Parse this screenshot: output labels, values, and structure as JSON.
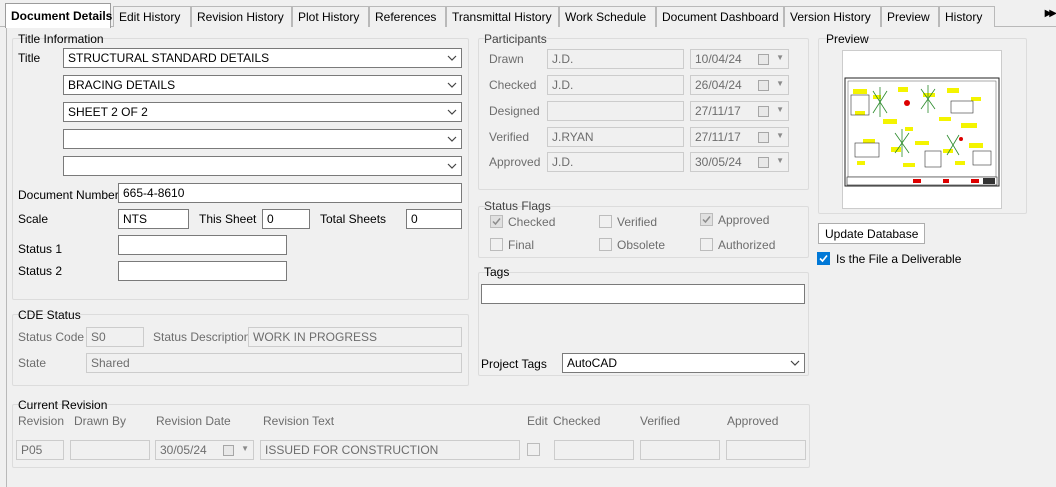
{
  "tabs": [
    {
      "label": "Document Details"
    },
    {
      "label": "Edit History"
    },
    {
      "label": "Revision History"
    },
    {
      "label": "Plot History"
    },
    {
      "label": "References"
    },
    {
      "label": "Transmittal History"
    },
    {
      "label": "Work Schedule"
    },
    {
      "label": "Document Dashboard"
    },
    {
      "label": "Version History"
    },
    {
      "label": "Preview"
    },
    {
      "label": "History"
    }
  ],
  "tab_scroll": "▶▶",
  "title_info": {
    "group_title": "Title Information",
    "title_label": "Title",
    "title_lines": [
      "STRUCTURAL STANDARD DETAILS",
      "BRACING DETAILS",
      "SHEET 2 OF 2",
      "",
      ""
    ],
    "doc_number_label": "Document Number",
    "doc_number": "665-4-8610",
    "scale_label": "Scale",
    "scale": "NTS",
    "this_sheet_label": "This Sheet",
    "this_sheet": "0",
    "total_sheets_label": "Total Sheets",
    "total_sheets": "0",
    "status1_label": "Status 1",
    "status1": "",
    "status2_label": "Status 2",
    "status2": ""
  },
  "participants": {
    "group_title": "Participants",
    "rows": [
      {
        "role": "Drawn",
        "name": "J.D.",
        "date": "10/04/24"
      },
      {
        "role": "Checked",
        "name": "J.D.",
        "date": "26/04/24"
      },
      {
        "role": "Designed",
        "name": "",
        "date": "27/11/17"
      },
      {
        "role": "Verified",
        "name": "J.RYAN",
        "date": "27/11/17"
      },
      {
        "role": "Approved",
        "name": "J.D.",
        "date": "30/05/24"
      }
    ]
  },
  "status_flags": {
    "group_title": "Status Flags",
    "flags": [
      {
        "label": "Checked",
        "checked": true
      },
      {
        "label": "Verified",
        "checked": false
      },
      {
        "label": "Approved",
        "checked": true
      },
      {
        "label": "Final",
        "checked": false
      },
      {
        "label": "Obsolete",
        "checked": false
      },
      {
        "label": "Authorized",
        "checked": false
      }
    ]
  },
  "tags": {
    "label": "Tags",
    "value": "",
    "project_tags_label": "Project Tags",
    "project_tags": "AutoCAD"
  },
  "preview": {
    "group_title": "Preview",
    "update_button": "Update Database",
    "deliverable_label": "Is the File a Deliverable",
    "deliverable_checked": true
  },
  "cde": {
    "group_title": "CDE Status",
    "status_code_label": "Status Code",
    "status_code": "S0",
    "status_desc_label": "Status Description",
    "status_desc": "WORK IN PROGRESS",
    "state_label": "State",
    "state": "Shared"
  },
  "current_revision": {
    "group_title": "Current Revision",
    "headers": {
      "revision": "Revision",
      "drawn_by": "Drawn By",
      "revision_date": "Revision Date",
      "revision_text": "Revision Text",
      "edit": "Edit",
      "checked": "Checked",
      "verified": "Verified",
      "approved": "Approved"
    },
    "revision": "P05",
    "drawn_by": "",
    "revision_date": "30/05/24",
    "revision_text": "ISSUED FOR CONSTRUCTION",
    "edit": false,
    "checked": "",
    "verified": "",
    "approved": ""
  },
  "colors": {
    "accent": "#0078d7",
    "disabled_text": "#6d6d6d",
    "panel": "#f0f0f0"
  }
}
